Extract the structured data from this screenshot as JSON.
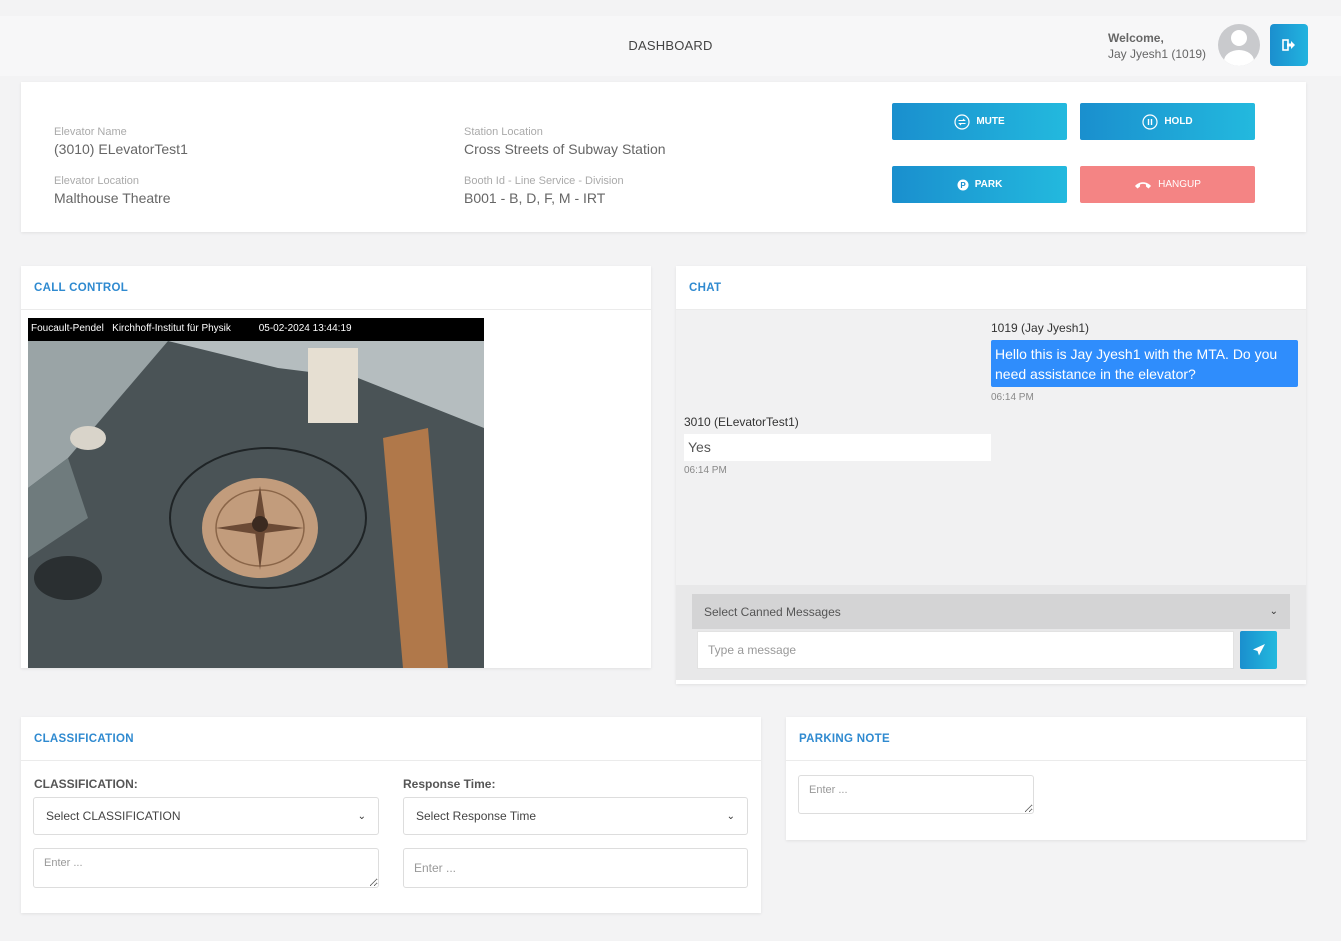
{
  "header": {
    "title": "DASHBOARD",
    "welcome_label": "Welcome,",
    "user_name": "Jay Jyesh1 (1019)"
  },
  "info": {
    "elevator_name_label": "Elevator Name",
    "elevator_name": "(3010) ELevatorTest1",
    "elevator_location_label": "Elevator Location",
    "elevator_location": "Malthouse Theatre",
    "station_location_label": "Station Location",
    "station_location": "Cross Streets of Subway Station",
    "booth_label": "Booth Id - Line Service - Division",
    "booth_value": "B001 - B, D, F, M - IRT"
  },
  "actions": {
    "mute": "MUTE",
    "hold": "HOLD",
    "park": "PARK",
    "hangup": "HANGUP"
  },
  "call_control": {
    "title": "CALL CONTROL",
    "video_overlay": {
      "camera": "Foucault-Pendel   Kirchhoff-Institut für Physik",
      "timestamp": "05-02-2024 13:44:19"
    }
  },
  "chat": {
    "title": "CHAT",
    "messages": [
      {
        "sender": "1019 (Jay Jyesh1)",
        "text": "Hello this is Jay Jyesh1 with the MTA. Do you need assistance in the elevator?",
        "time": "06:14 PM"
      },
      {
        "sender": "3010 (ELevatorTest1)",
        "text": "Yes",
        "time": "06:14 PM"
      }
    ],
    "canned_placeholder": "Select Canned Messages",
    "input_placeholder": "Type a message"
  },
  "classification": {
    "title": "CLASSIFICATION",
    "class_label": "CLASSIFICATION:",
    "class_select": "Select CLASSIFICATION",
    "class_note_placeholder": "Enter ...",
    "response_label": "Response Time:",
    "response_select": "Select Response Time",
    "response_note_placeholder": "Enter ..."
  },
  "parking": {
    "title": "PARKING NOTE",
    "note_placeholder": "Enter ..."
  },
  "colors": {
    "accent": "#2f8ad0",
    "button_blue": "#1a8fce",
    "hangup_red": "#f48484",
    "chat_bubble": "#2f8dfc"
  }
}
